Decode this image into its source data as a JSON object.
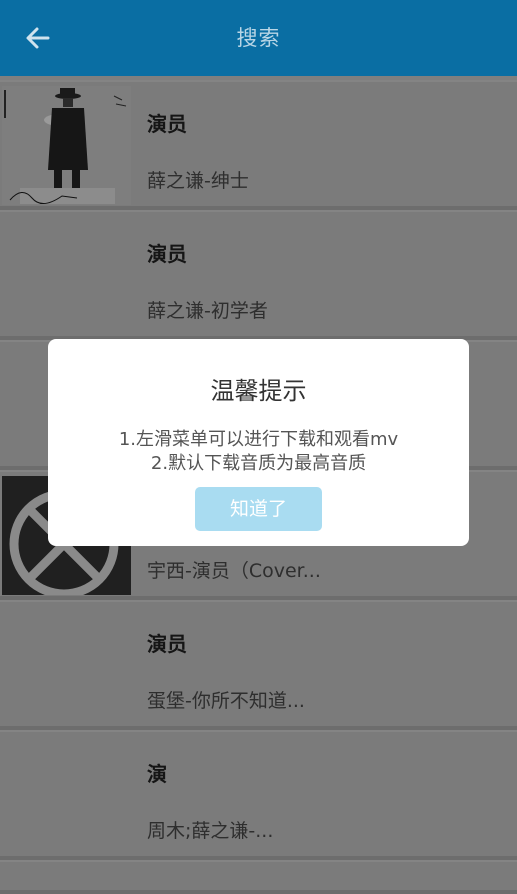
{
  "header": {
    "title": "搜索",
    "back_icon": "arrow-left-icon",
    "background": "#0a6ea3"
  },
  "results": [
    {
      "song": "演员",
      "artist": "薛之谦-绅士",
      "thumb": "album-cover-gentleman"
    },
    {
      "song": "演员",
      "artist": "薛之谦-初学者",
      "thumb": ""
    },
    {
      "song": "",
      "artist": "",
      "thumb": ""
    },
    {
      "song": "",
      "artist": "宇西-演员（Cover...",
      "thumb": "album-cover-circle-x"
    },
    {
      "song": "演员",
      "artist": "蛋堡-你所不知道...",
      "thumb": ""
    },
    {
      "song": "演",
      "artist": "周木;薛之谦-...",
      "thumb": ""
    }
  ],
  "dialog": {
    "title": "温馨提示",
    "line1": "1.左滑菜单可以进行下载和观看mv",
    "line2": "2.默认下载音质为最高音质",
    "ok_label": "知道了",
    "button_color": "#a9dcf1"
  }
}
